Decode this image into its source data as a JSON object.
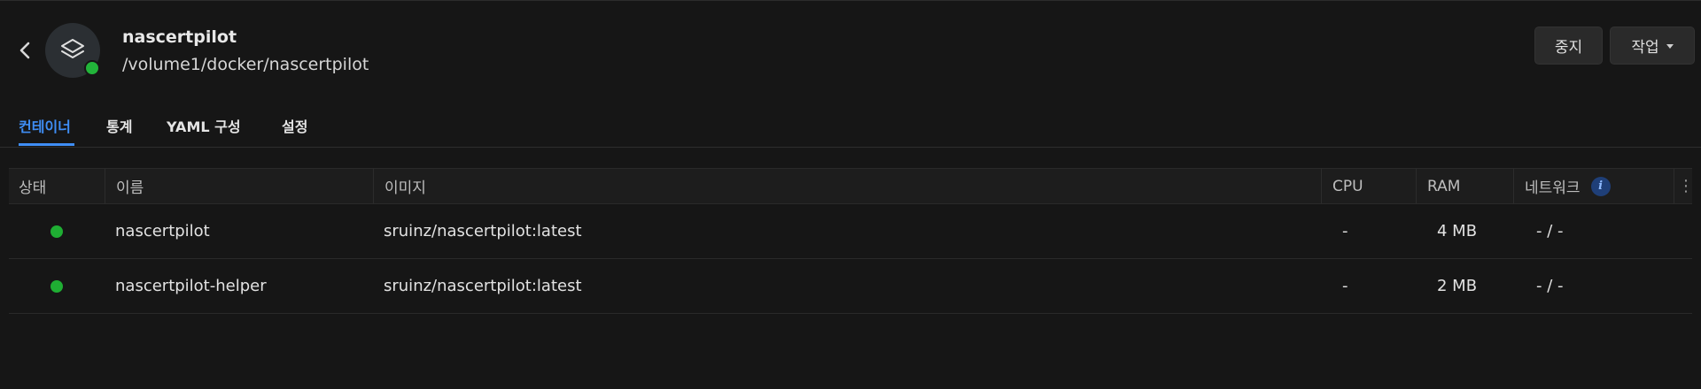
{
  "header": {
    "project_name": "nascertpilot",
    "project_path": "/volume1/docker/nascertpilot",
    "status_color": "#22b43a",
    "stop_label": "중지",
    "action_label": "작업"
  },
  "tabs": [
    {
      "label": "컨테이너",
      "active": true
    },
    {
      "label": "통계",
      "active": false
    },
    {
      "label": "YAML 구성",
      "active": false
    },
    {
      "label": "설정",
      "active": false
    }
  ],
  "table": {
    "columns": {
      "status": "상태",
      "name": "이름",
      "image": "이미지",
      "cpu": "CPU",
      "ram": "RAM",
      "network": "네트워크"
    },
    "rows": [
      {
        "status": "running",
        "name": "nascertpilot",
        "image": "sruinz/nascertpilot:latest",
        "cpu": "-",
        "ram": "4 MB",
        "network": "- / -"
      },
      {
        "status": "running",
        "name": "nascertpilot-helper",
        "image": "sruinz/nascertpilot:latest",
        "cpu": "-",
        "ram": "2 MB",
        "network": "- / -"
      }
    ]
  },
  "colors": {
    "accent": "#3f8ef5",
    "running": "#1fae33",
    "background": "#161616"
  },
  "icons": {
    "back": "chevron-left-icon",
    "project": "layers-icon",
    "info": "info-icon",
    "menu": "more-vertical-icon"
  }
}
